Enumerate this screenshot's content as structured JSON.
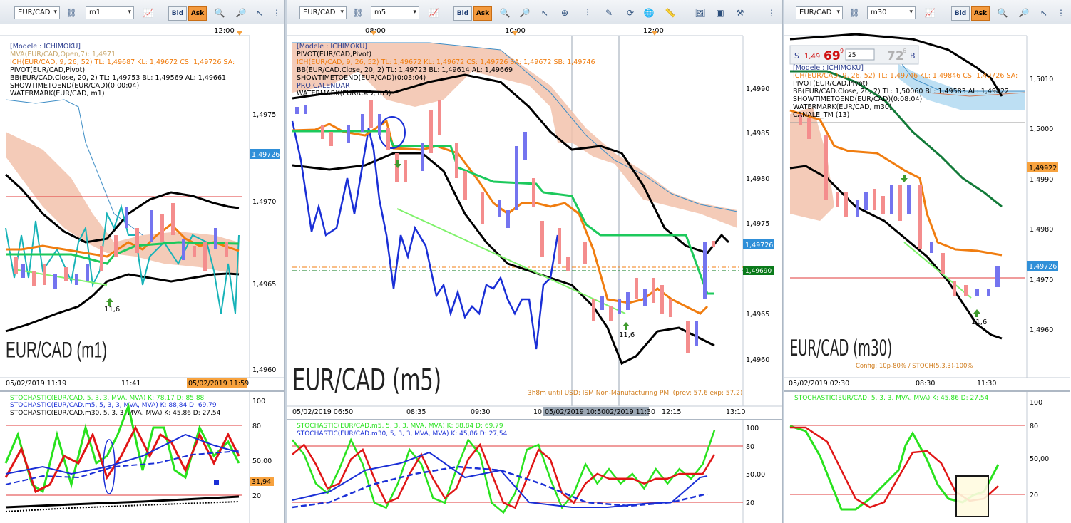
{
  "colors": {
    "black_line": "#000000",
    "blue_line": "#1a2fd6",
    "green_line": "#1dc95c",
    "orange_line": "#f07d10",
    "lightgreen_line": "#7ff26b",
    "teal_line": "#18b3b8",
    "cloud_fill": "#f2c2ac",
    "red_hline": "#e23a3a",
    "bull_candle": "#7474ef",
    "bear_candle": "#f48d8d",
    "price_tag": "#2f8fd8",
    "orange_tag": "#f7a23e",
    "green_tag": "#0a7a1a",
    "dark_green_line": "#127a38",
    "stoch_green": "#29e21e",
    "stoch_red": "#e01616"
  },
  "panels": [
    {
      "id": "m1",
      "symbol": "EUR/CAD",
      "timeframe": "m1",
      "toolbar": {
        "bid_label": "Bid",
        "ask_label": "Ask"
      },
      "top_time_label": "12:00",
      "legend": [
        {
          "text": "[Modele : ICHIMOKU]",
          "color": "#2b3d8f"
        },
        {
          "text": "MVA(EUR/CAD,Open,7): 1,4971",
          "color": "#c8a86e"
        },
        {
          "text": "ICH(EUR/CAD, 9, 26, 52)  TL: 1,49687  KL: 1,49672  CS: 1,49726  SA:",
          "color": "#f07d10"
        },
        {
          "text": "PIVOT(EUR/CAD,Pivot)",
          "color": "#000000"
        },
        {
          "text": "BB(EUR/CAD.Close, 20, 2)  TL: 1,49753  BL: 1,49569  AL: 1,49661",
          "color": "#000000"
        },
        {
          "text": "SHOWTIMETOEND(EUR/CAD)(0:00:04)",
          "color": "#000000"
        },
        {
          "text": "WATERMARK(EUR/CAD, m1)",
          "color": "#000000"
        }
      ],
      "price_ticks": [
        "1,4975",
        "1,4970",
        "1,4965",
        "1,4960"
      ],
      "price_tag": "1,49726",
      "watermark": "EUR/CAD (m1)",
      "marker_label": "11,6",
      "time_labels": [
        "05/02/2019 11:19",
        "11:41"
      ],
      "time_highlight": "05/02/2019 11:59",
      "osc_legend": [
        {
          "text": "STOCHASTIC(EUR/CAD, 5, 3, 3, MVA, MVA)  K: 78,17  D: 85,88",
          "color": "#29e21e"
        },
        {
          "text": "STOCHASTIC(EUR/CAD.m5, 5, 3, 3, MVA, MVA)  K: 88,84  D: 69,79",
          "color": "#1a2fd6"
        },
        {
          "text": "STOCHASTIC(EUR/CAD.m30, 5, 3, 3, MVA, MVA)  K: 45,86  D: 27,54",
          "color": "#000000"
        }
      ],
      "osc_ticks": [
        "100",
        "80",
        "50,00",
        "20"
      ],
      "osc_tag": "31,94"
    },
    {
      "id": "m5",
      "symbol": "EUR/CAD",
      "timeframe": "m5",
      "toolbar": {
        "bid_label": "Bid",
        "ask_label": "Ask"
      },
      "top_time_labels": [
        "08:00",
        "10:00",
        "12:00"
      ],
      "legend": [
        {
          "text": "[Modele : ICHIMOKU]",
          "color": "#2b3d8f"
        },
        {
          "text": "PIVOT(EUR/CAD,Pivot)",
          "color": "#000000"
        },
        {
          "text": "ICH(EUR/CAD, 9, 26, 52)  TL: 1,49672  KL: 1,49672  CS: 1,49726  SA: 1,49672  SB: 1,49746",
          "color": "#f07d10"
        },
        {
          "text": "BB(EUR/CAD.Close, 20, 2)  TL: 1,49723  BL: 1,49614  AL: 1,49669",
          "color": "#000000"
        },
        {
          "text": "SHOWTIMETOEND(EUR/CAD)(0:03:04)",
          "color": "#000000"
        },
        {
          "text": "PRO CALENDAR",
          "color": "#2b3d8f"
        },
        {
          "text": "WATERMARK(EUR/CAD, m5)",
          "color": "#000000"
        }
      ],
      "price_ticks": [
        "1,4990",
        "1,4985",
        "1,4980",
        "1,4975",
        "1,4965",
        "1,4960"
      ],
      "price_tag": "1,49726",
      "price_tag2": "1,49690",
      "watermark": "EUR/CAD (m5)",
      "marker_label": "11,6",
      "news_text": "3h8m until USD: ISM Non-Manufacturing PMI (prev: 57.6 exp: 57.2)",
      "time_labels": [
        "05/02/2019 06:50",
        "08:35",
        "09:30",
        "10:",
        "12:15",
        "13:10"
      ],
      "time_highlight": "05/02/2019 10:5002/2019 11:30",
      "osc_legend": [
        {
          "text": "STOCHASTIC(EUR/CAD.m5, 5, 3, 3, MVA, MVA)  K: 88,84  D: 69,79",
          "color": "#29e21e"
        },
        {
          "text": "STOCHASTIC(EUR/CAD.m30, 5, 3, 3, MVA, MVA)  K: 45,86  D: 27,54",
          "color": "#1a2fd6"
        }
      ],
      "osc_ticks": [
        "100",
        "80",
        "50,00",
        "20"
      ]
    },
    {
      "id": "m30",
      "symbol": "EUR/CAD",
      "timeframe": "m30",
      "toolbar": {
        "bid_label": "Bid",
        "ask_label": "Ask"
      },
      "ticket": {
        "side": "S",
        "big": "1,49",
        "pips": "69",
        "sup": "9",
        "qty": "25",
        "buy_pips": "72",
        "buy_sup": "6",
        "buy_side": "B"
      },
      "legend": [
        {
          "text": "[Modele : ICHIMOKU]",
          "color": "#2b3d8f"
        },
        {
          "text": "ICH(EUR/CAD, 9, 26, 52)  TL: 1,49746  KL: 1,49846  CS: 1,49726  SA:",
          "color": "#f07d10"
        },
        {
          "text": "PIVOT(EUR/CAD,Pivot)",
          "color": "#000000"
        },
        {
          "text": "BB(EUR/CAD.Close, 20, 2)  TL: 1,50060  BL: 1,49583  AL: 1,49822",
          "color": "#000000"
        },
        {
          "text": "SHOWTIMETOEND(EUR/CAD)(0:08:04)",
          "color": "#000000"
        },
        {
          "text": "WATERMARK(EUR/CAD, m30)",
          "color": "#000000"
        },
        {
          "text": "CANALE_TM (13)",
          "color": "#000000"
        }
      ],
      "price_ticks": [
        "1,5010",
        "1,5000",
        "1,4990",
        "1,4980",
        "1,4970",
        "1,4960"
      ],
      "price_tag": "1,49726",
      "price_tag2": "1,49922",
      "watermark": "EUR/CAD (m30)",
      "marker_label": "11,6",
      "config_text": "Config: 10p-80% / STOCH(5,3,3)-100%",
      "time_labels": [
        "05/02/2019 02:30",
        "08:30",
        "11:30"
      ],
      "osc_legend": [
        {
          "text": "STOCHASTIC(EUR/CAD, 5, 3, 3, MVA, MVA)  K: 45,86  D: 27,54",
          "color": "#29e21e"
        }
      ],
      "osc_ticks": [
        "100",
        "80",
        "50,00",
        "20"
      ]
    }
  ],
  "chart_data": [
    {
      "type": "line",
      "name": "stochastic-m5",
      "ylim": [
        0,
        100
      ],
      "series": [
        {
          "name": "K",
          "values": [
            85,
            70,
            40,
            30,
            55,
            85,
            60,
            20,
            15,
            40,
            75,
            60,
            25,
            20,
            55,
            85,
            70,
            20,
            10,
            30,
            75,
            80,
            45,
            15,
            30,
            60,
            40,
            55,
            40,
            50,
            35,
            55,
            40,
            55,
            45,
            60,
            95
          ]
        },
        {
          "name": "D",
          "values": [
            70,
            80,
            60,
            35,
            40,
            65,
            75,
            45,
            20,
            25,
            50,
            70,
            45,
            25,
            35,
            65,
            80,
            50,
            20,
            15,
            45,
            75,
            65,
            30,
            20,
            40,
            50,
            45,
            45,
            45,
            40,
            45,
            45,
            50,
            50,
            50,
            70
          ]
        }
      ]
    }
  ]
}
